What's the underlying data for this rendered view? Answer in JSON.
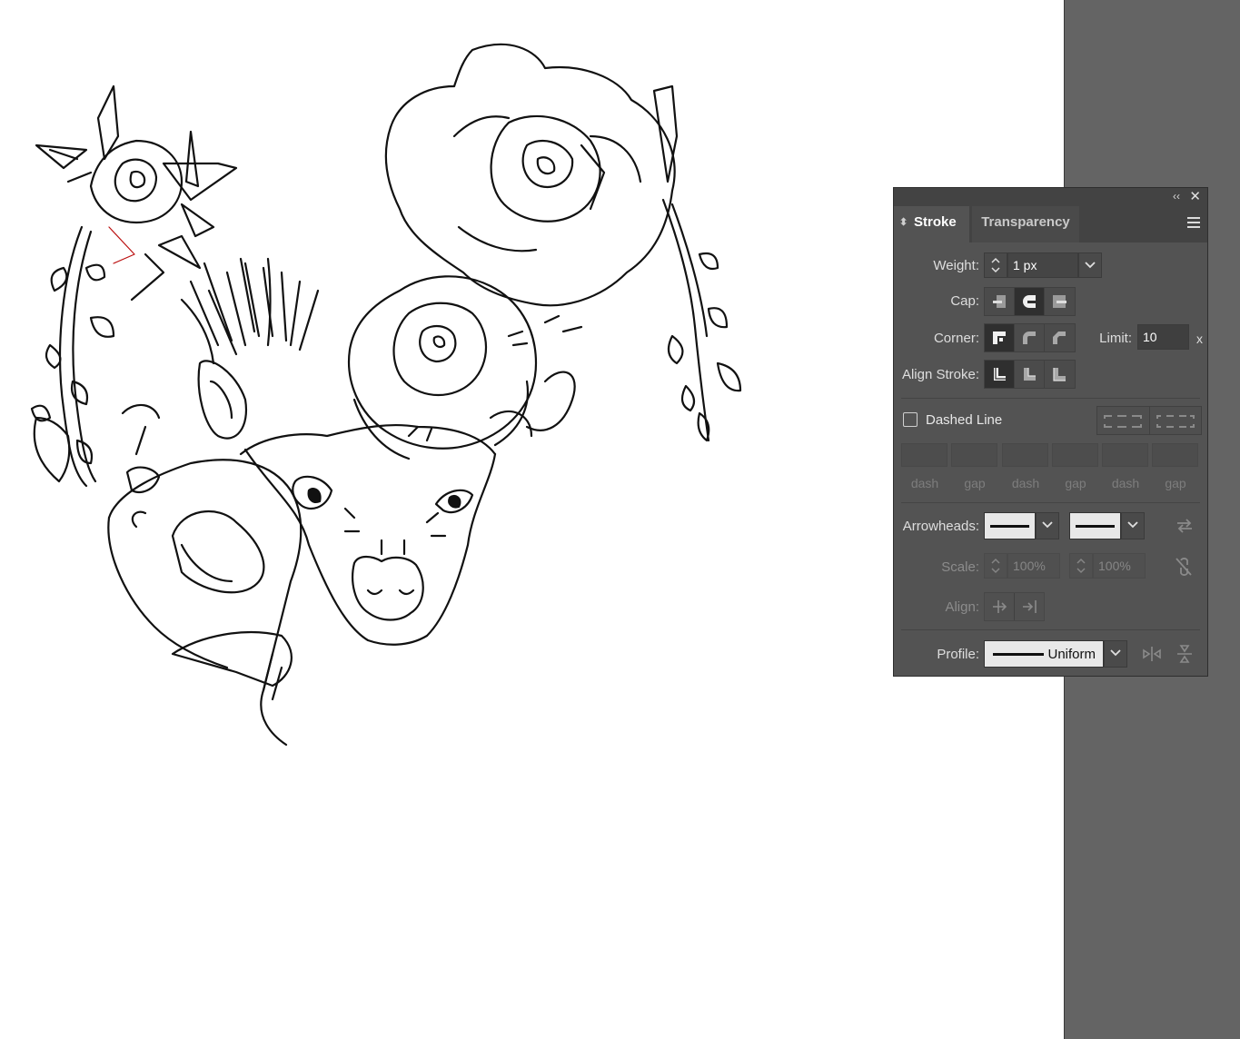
{
  "panel": {
    "collapse_glyph": "‹‹",
    "close_glyph": "✕",
    "tabs": {
      "stroke": "Stroke",
      "transparency": "Transparency"
    },
    "weight": {
      "label": "Weight:",
      "value": "1 px"
    },
    "cap": {
      "label": "Cap:",
      "options": [
        "butt-cap-icon",
        "round-cap-icon",
        "projecting-cap-icon"
      ],
      "selected": "round-cap-icon"
    },
    "corner": {
      "label": "Corner:",
      "options": [
        "miter-join-icon",
        "round-join-icon",
        "bevel-join-icon"
      ],
      "selected": "miter-join-icon"
    },
    "limit": {
      "label": "Limit:",
      "value": "10",
      "unit": "x"
    },
    "align_stroke": {
      "label": "Align Stroke:",
      "options": [
        "align-center-icon",
        "align-inside-icon",
        "align-outside-icon"
      ],
      "selected": "align-center-icon"
    },
    "dashed": {
      "label": "Dashed Line",
      "checked": false
    },
    "dash_labels": [
      "dash",
      "gap",
      "dash",
      "gap",
      "dash",
      "gap"
    ],
    "arrowheads": {
      "label": "Arrowheads:"
    },
    "scale": {
      "label": "Scale:",
      "start": "100%",
      "end": "100%"
    },
    "align": {
      "label": "Align:"
    },
    "profile": {
      "label": "Profile:",
      "value": "Uniform"
    }
  },
  "colors": {
    "panel_bg": "#535353",
    "tab_bar": "#434343",
    "pasteboard": "#646464",
    "artboard": "#ffffff"
  }
}
